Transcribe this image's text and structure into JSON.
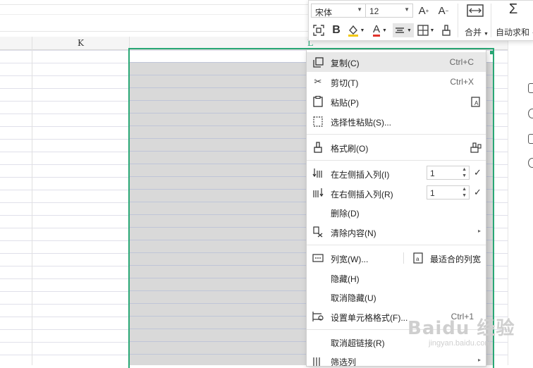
{
  "sheet": {
    "columns": [
      "K",
      "L"
    ]
  },
  "toolbar": {
    "font_name": "宋体",
    "font_size": "12",
    "merge_label": "合并",
    "autosum_label": "自动求和",
    "icons": [
      "grow-font-icon",
      "shrink-font-icon",
      "merge-cells-icon",
      "sum-icon",
      "cell-format-icon",
      "bold-icon",
      "fill-color-icon",
      "font-color-icon",
      "align-icon",
      "border-icon",
      "format-painter-icon"
    ]
  },
  "menu": {
    "copy": {
      "label": "复制(C)",
      "shortcut": "Ctrl+C"
    },
    "cut": {
      "label": "剪切(T)",
      "shortcut": "Ctrl+X"
    },
    "paste": {
      "label": "粘贴(P)"
    },
    "paste_special": {
      "label": "选择性粘贴(S)..."
    },
    "format_painter": {
      "label": "格式刷(O)"
    },
    "insert_left": {
      "label": "在左侧插入列(I)",
      "value": "1"
    },
    "insert_right": {
      "label": "在右侧插入列(R)",
      "value": "1"
    },
    "delete": {
      "label": "删除(D)"
    },
    "clear": {
      "label": "清除内容(N)"
    },
    "col_width": {
      "label": "列宽(W)...",
      "best_fit": "最适合的列宽"
    },
    "hide": {
      "label": "隐藏(H)"
    },
    "unhide": {
      "label": "取消隐藏(U)"
    },
    "cell_format": {
      "label": "设置单元格格式(F)...",
      "shortcut": "Ctrl+1"
    },
    "remove_hyperlink": {
      "label": "取消超链接(R)"
    },
    "filter": {
      "label": "筛选列"
    }
  },
  "watermark": {
    "brand": "Baidu 经验",
    "url": "jingyan.baidu.com"
  }
}
